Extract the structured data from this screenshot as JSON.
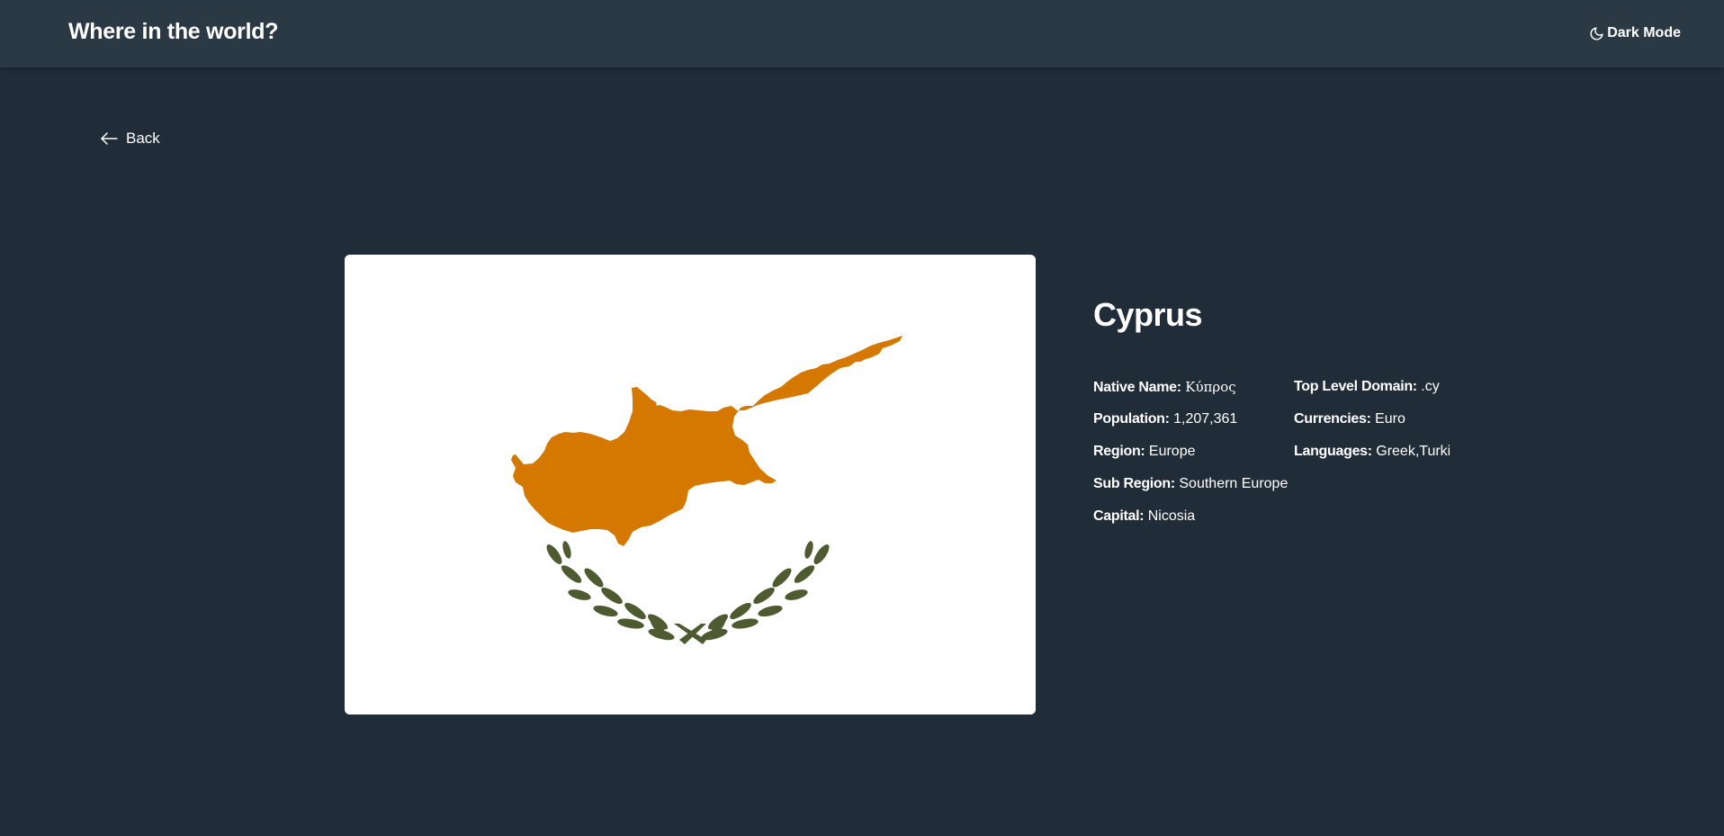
{
  "header": {
    "title": "Where in the world?",
    "mode_toggle": {
      "icon": "moon-icon",
      "label": "Dark Mode"
    }
  },
  "back_button": {
    "icon": "arrow-left-icon",
    "label": "Back"
  },
  "country": {
    "name": "Cyprus",
    "flag": {
      "island_color": "#d57800",
      "branches_color": "#4e5b31",
      "background_color": "#ffffff"
    },
    "details_left": [
      {
        "label": "Native Name:",
        "value": "Κύπρος"
      },
      {
        "label": "Population:",
        "value": "1,207,361"
      },
      {
        "label": "Region:",
        "value": "Europe"
      },
      {
        "label": "Sub Region:",
        "value": "Southern Europe"
      },
      {
        "label": "Capital:",
        "value": "Nicosia"
      }
    ],
    "details_right": [
      {
        "label": "Top Level Domain:",
        "value": ".cy"
      },
      {
        "label": "Currencies:",
        "value": "Euro"
      },
      {
        "label": "Languages:",
        "value": "Greek,Turkish"
      }
    ]
  },
  "colors": {
    "background": "#202c37",
    "header": "#2b3945",
    "text": "#ffffff"
  }
}
